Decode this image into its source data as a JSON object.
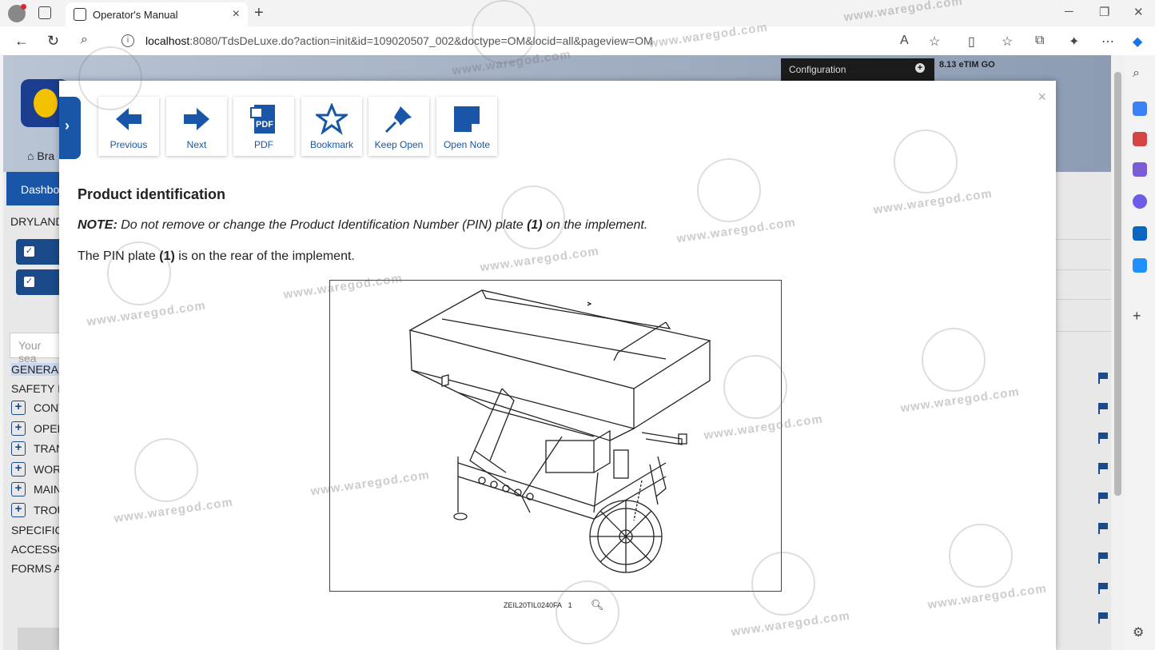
{
  "browser": {
    "tab_title": "Operator's Manual",
    "url_host": "localhost",
    "url_rest": ":8080/TdsDeLuxe.do?action=init&id=109020507_002&doctype=OM&locid=all&pageview=OM"
  },
  "background": {
    "config_label": "Configuration",
    "version": "8.13 eTIM GO",
    "crumb": "Bra",
    "dashboard_tab": "Dashbo",
    "section_label": "DRYLAND",
    "search_placeholder": "Your sea",
    "tree": [
      {
        "label": "GENERAL",
        "expandable": false,
        "selected": true
      },
      {
        "label": "SAFETY I",
        "expandable": false,
        "selected": false
      },
      {
        "label": "CONT",
        "expandable": true,
        "selected": false
      },
      {
        "label": "OPER",
        "expandable": true,
        "selected": false
      },
      {
        "label": "TRAN",
        "expandable": true,
        "selected": false
      },
      {
        "label": "WOR",
        "expandable": true,
        "selected": false
      },
      {
        "label": "MAIN",
        "expandable": true,
        "selected": false
      },
      {
        "label": "TROU",
        "expandable": true,
        "selected": false
      },
      {
        "label": "SPECIFIC",
        "expandable": false,
        "selected": false
      },
      {
        "label": "ACCESSO",
        "expandable": false,
        "selected": false
      },
      {
        "label": "FORMS A",
        "expandable": false,
        "selected": false
      }
    ]
  },
  "toolbar": {
    "buttons": [
      {
        "label": "Previous",
        "icon": "arrow-left-icon"
      },
      {
        "label": "Next",
        "icon": "arrow-right-icon"
      },
      {
        "label": "PDF",
        "icon": "pdf-icon"
      },
      {
        "label": "Bookmark",
        "icon": "star-icon"
      },
      {
        "label": "Keep Open",
        "icon": "pin-icon"
      },
      {
        "label": "Open Note",
        "icon": "note-icon"
      }
    ]
  },
  "document": {
    "title": "Product identification",
    "note_prefix": "NOTE:",
    "note_text_1": "Do not remove or change the Product Identification Number (PIN) plate",
    "note_ref": "(1)",
    "note_text_2": "on the implement.",
    "body_text_1": "The PIN plate",
    "body_ref": "(1)",
    "body_text_2": "is on the rear of the implement.",
    "figure_caption": "ZEIL20TIL0240FA",
    "figure_callout": "1"
  },
  "watermark": {
    "text": "www.waregod.com"
  },
  "colors": {
    "accent": "#1a56a8",
    "header_dark": "#1b1b1b"
  }
}
